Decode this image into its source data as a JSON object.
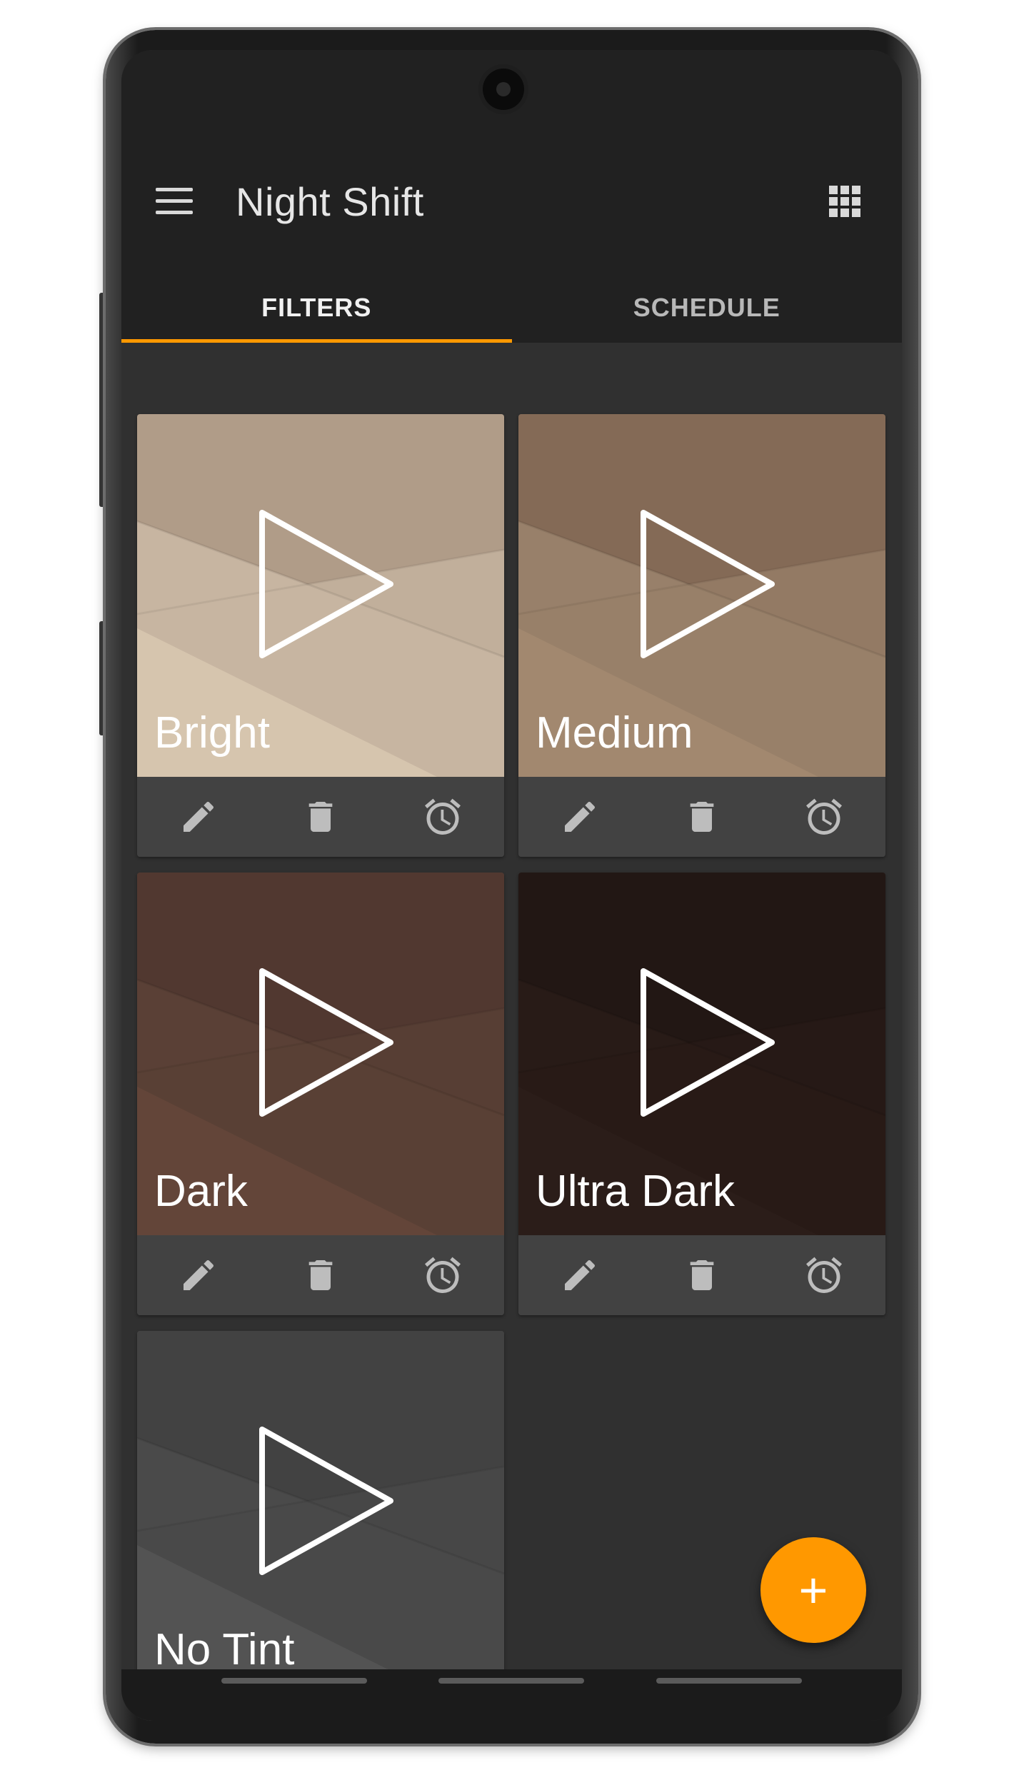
{
  "app": {
    "title": "Night Shift",
    "menu_icon": "menu-icon",
    "grid_icon": "apps-grid-icon"
  },
  "tabs": [
    {
      "label": "FILTERS",
      "active": true
    },
    {
      "label": "SCHEDULE",
      "active": false
    }
  ],
  "filters": [
    {
      "name": "Bright",
      "colors": {
        "top": "#b09c88",
        "mid": "#c7b5a1",
        "low": "#d6c5ae"
      }
    },
    {
      "name": "Medium",
      "colors": {
        "top": "#846a56",
        "mid": "#98806a",
        "low": "#a2886f"
      }
    },
    {
      "name": "Dark",
      "colors": {
        "top": "#513830",
        "mid": "#5a4036",
        "low": "#634539"
      }
    },
    {
      "name": "Ultra Dark",
      "colors": {
        "top": "#221714",
        "mid": "#281b17",
        "low": "#2b1d19"
      }
    },
    {
      "name": "No Tint",
      "colors": {
        "top": "#424242",
        "mid": "#4a4a4a",
        "low": "#535353"
      }
    }
  ],
  "card_actions": [
    "edit-icon",
    "delete-icon",
    "alarm-icon"
  ],
  "fab": {
    "label": "+",
    "icon": "add-icon"
  },
  "accent_color": "#ff9800"
}
